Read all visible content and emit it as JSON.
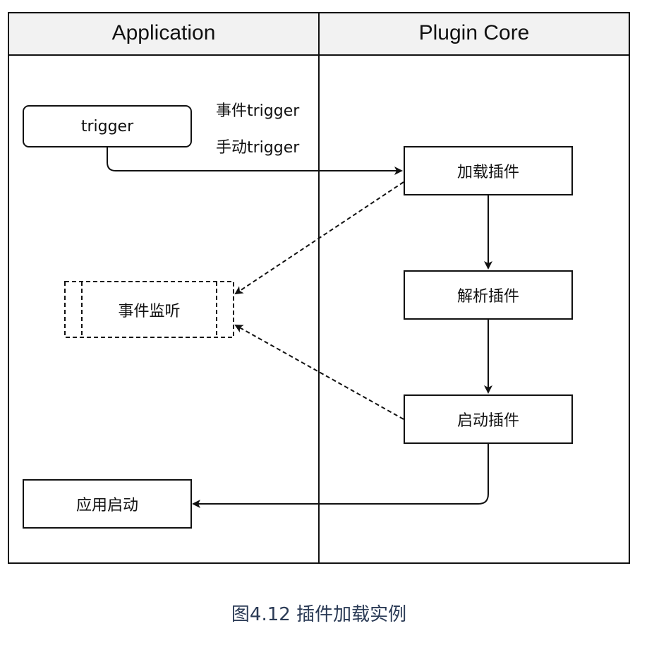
{
  "lanes": {
    "left": "Application",
    "right": "Plugin Core"
  },
  "nodes": {
    "trigger": "trigger",
    "event_trigger_label": "事件trigger",
    "manual_trigger_label": "手动trigger",
    "event_listen": "事件监听",
    "app_start": "应用启动",
    "load_plugin": "加载插件",
    "parse_plugin": "解析插件",
    "start_plugin": "启动插件"
  },
  "caption": "图4.12 插件加载实例"
}
